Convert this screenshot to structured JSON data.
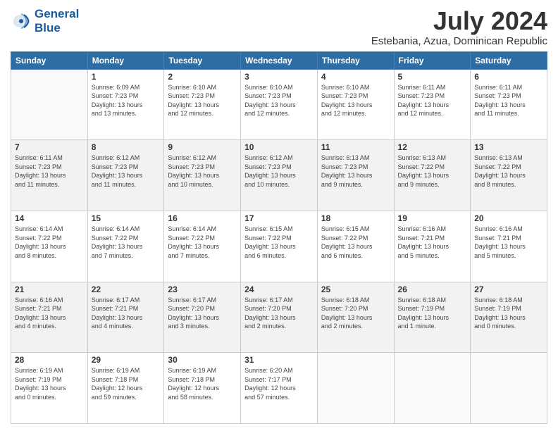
{
  "logo": {
    "line1": "General",
    "line2": "Blue"
  },
  "title": "July 2024",
  "location": "Estebania, Azua, Dominican Republic",
  "weekdays": [
    "Sunday",
    "Monday",
    "Tuesday",
    "Wednesday",
    "Thursday",
    "Friday",
    "Saturday"
  ],
  "days": [
    {
      "date": "",
      "info": ""
    },
    {
      "date": "1",
      "info": "Sunrise: 6:09 AM\nSunset: 7:23 PM\nDaylight: 13 hours\nand 13 minutes."
    },
    {
      "date": "2",
      "info": "Sunrise: 6:10 AM\nSunset: 7:23 PM\nDaylight: 13 hours\nand 12 minutes."
    },
    {
      "date": "3",
      "info": "Sunrise: 6:10 AM\nSunset: 7:23 PM\nDaylight: 13 hours\nand 12 minutes."
    },
    {
      "date": "4",
      "info": "Sunrise: 6:10 AM\nSunset: 7:23 PM\nDaylight: 13 hours\nand 12 minutes."
    },
    {
      "date": "5",
      "info": "Sunrise: 6:11 AM\nSunset: 7:23 PM\nDaylight: 13 hours\nand 12 minutes."
    },
    {
      "date": "6",
      "info": "Sunrise: 6:11 AM\nSunset: 7:23 PM\nDaylight: 13 hours\nand 11 minutes."
    },
    {
      "date": "7",
      "info": "Sunrise: 6:11 AM\nSunset: 7:23 PM\nDaylight: 13 hours\nand 11 minutes."
    },
    {
      "date": "8",
      "info": "Sunrise: 6:12 AM\nSunset: 7:23 PM\nDaylight: 13 hours\nand 11 minutes."
    },
    {
      "date": "9",
      "info": "Sunrise: 6:12 AM\nSunset: 7:23 PM\nDaylight: 13 hours\nand 10 minutes."
    },
    {
      "date": "10",
      "info": "Sunrise: 6:12 AM\nSunset: 7:23 PM\nDaylight: 13 hours\nand 10 minutes."
    },
    {
      "date": "11",
      "info": "Sunrise: 6:13 AM\nSunset: 7:23 PM\nDaylight: 13 hours\nand 9 minutes."
    },
    {
      "date": "12",
      "info": "Sunrise: 6:13 AM\nSunset: 7:22 PM\nDaylight: 13 hours\nand 9 minutes."
    },
    {
      "date": "13",
      "info": "Sunrise: 6:13 AM\nSunset: 7:22 PM\nDaylight: 13 hours\nand 8 minutes."
    },
    {
      "date": "14",
      "info": "Sunrise: 6:14 AM\nSunset: 7:22 PM\nDaylight: 13 hours\nand 8 minutes."
    },
    {
      "date": "15",
      "info": "Sunrise: 6:14 AM\nSunset: 7:22 PM\nDaylight: 13 hours\nand 7 minutes."
    },
    {
      "date": "16",
      "info": "Sunrise: 6:14 AM\nSunset: 7:22 PM\nDaylight: 13 hours\nand 7 minutes."
    },
    {
      "date": "17",
      "info": "Sunrise: 6:15 AM\nSunset: 7:22 PM\nDaylight: 13 hours\nand 6 minutes."
    },
    {
      "date": "18",
      "info": "Sunrise: 6:15 AM\nSunset: 7:22 PM\nDaylight: 13 hours\nand 6 minutes."
    },
    {
      "date": "19",
      "info": "Sunrise: 6:16 AM\nSunset: 7:21 PM\nDaylight: 13 hours\nand 5 minutes."
    },
    {
      "date": "20",
      "info": "Sunrise: 6:16 AM\nSunset: 7:21 PM\nDaylight: 13 hours\nand 5 minutes."
    },
    {
      "date": "21",
      "info": "Sunrise: 6:16 AM\nSunset: 7:21 PM\nDaylight: 13 hours\nand 4 minutes."
    },
    {
      "date": "22",
      "info": "Sunrise: 6:17 AM\nSunset: 7:21 PM\nDaylight: 13 hours\nand 4 minutes."
    },
    {
      "date": "23",
      "info": "Sunrise: 6:17 AM\nSunset: 7:20 PM\nDaylight: 13 hours\nand 3 minutes."
    },
    {
      "date": "24",
      "info": "Sunrise: 6:17 AM\nSunset: 7:20 PM\nDaylight: 13 hours\nand 2 minutes."
    },
    {
      "date": "25",
      "info": "Sunrise: 6:18 AM\nSunset: 7:20 PM\nDaylight: 13 hours\nand 2 minutes."
    },
    {
      "date": "26",
      "info": "Sunrise: 6:18 AM\nSunset: 7:19 PM\nDaylight: 13 hours\nand 1 minute."
    },
    {
      "date": "27",
      "info": "Sunrise: 6:18 AM\nSunset: 7:19 PM\nDaylight: 13 hours\nand 0 minutes."
    },
    {
      "date": "28",
      "info": "Sunrise: 6:19 AM\nSunset: 7:19 PM\nDaylight: 13 hours\nand 0 minutes."
    },
    {
      "date": "29",
      "info": "Sunrise: 6:19 AM\nSunset: 7:18 PM\nDaylight: 12 hours\nand 59 minutes."
    },
    {
      "date": "30",
      "info": "Sunrise: 6:19 AM\nSunset: 7:18 PM\nDaylight: 12 hours\nand 58 minutes."
    },
    {
      "date": "31",
      "info": "Sunrise: 6:20 AM\nSunset: 7:17 PM\nDaylight: 12 hours\nand 57 minutes."
    },
    {
      "date": "",
      "info": ""
    },
    {
      "date": "",
      "info": ""
    },
    {
      "date": "",
      "info": ""
    }
  ]
}
